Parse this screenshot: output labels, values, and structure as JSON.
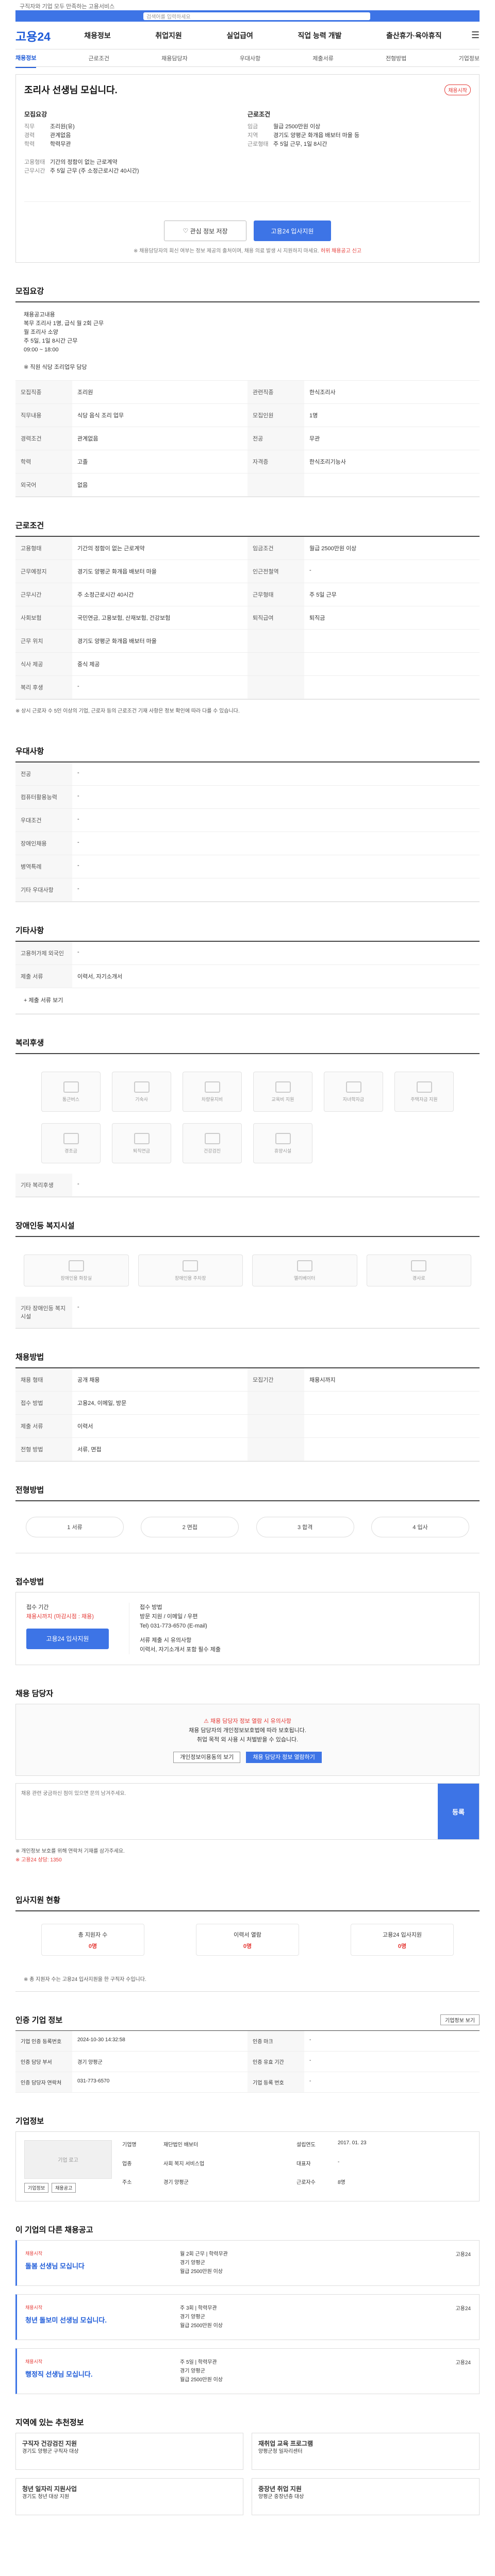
{
  "top": {
    "note": "구직자와 기업 모두 만족하는 고용서비스",
    "search_placeholder": "검색어를 입력하세요"
  },
  "gnb": {
    "logo": "고용24",
    "menu": [
      "채용정보",
      "취업지원",
      "실업급여",
      "직업 능력 개발",
      "출산휴가·육아휴직"
    ]
  },
  "tabs": [
    "채용정보",
    "근로조건",
    "채용담당자",
    "우대사항",
    "제출서류",
    "전형방법",
    "기업정보"
  ],
  "job": {
    "badge": "채용시작",
    "title": "조리사 선생님 모십니다.",
    "recruit_label": "모집요강",
    "cond_label": "근로조건",
    "recruit": [
      {
        "k": "직무",
        "v": "조리원(유)"
      },
      {
        "k": "경력",
        "v": "관계없음"
      },
      {
        "k": "학력",
        "v": "학력무관"
      }
    ],
    "cond": [
      {
        "k": "임금",
        "v": "월급 2500만원 이상"
      },
      {
        "k": "지역",
        "v": "경기도 양평군 화개읍 배보터 마을 등"
      },
      {
        "k": "근로형태",
        "v": "주 5일 근무, 1일 8시간"
      }
    ],
    "contact_k": "고용형태",
    "contact_v": "기간의 정함이 없는 근로계약",
    "time_k": "근무시간",
    "time_v": "주 5일 근무 (주 소정근로시간 40시간)",
    "btn_scrap": "관심 정보 저장",
    "btn_apply": "고용24 입사지원",
    "note": "※ 채용담당자의 회신 여부는 정보 제공의 출처이며, 채용 의료 발생 시 지원하지 마세요.",
    "note_hl": "허위 채용공고 신고"
  },
  "sec_recruit": {
    "title": "모집요강",
    "text": "채용공고내용\n복무 조리사 1명, 급식 월 2회 근무\n월 조리사 소양\n주 5일, 1일 8시간 근무\n09:00 ~ 18:00\n\n※ 직원 식당 조리업무 담당",
    "rows": [
      [
        "모집직종",
        "조리원",
        "관련직종",
        "한식조리사"
      ],
      [
        "직무내용",
        "식당 음식 조리 업무",
        "모집인원",
        "1명"
      ],
      [
        "경력조건",
        "관계없음",
        "전공",
        "무관"
      ],
      [
        "학력",
        "고졸",
        "자격증",
        "한식조리기능사"
      ],
      [
        "외국어",
        "없음",
        "",
        ""
      ]
    ]
  },
  "sec_cond": {
    "title": "근로조건",
    "rows": [
      [
        "고용형태",
        "기간의 정함이 없는 근로계약",
        "임금조건",
        "월급 2500만원 이상"
      ],
      [
        "근무예정지",
        "경기도 양평군 화개읍 배보터 마을",
        "인근전철역",
        "-"
      ],
      [
        "근무시간",
        "주 소정근로시간 40시간",
        "근무형태",
        "주 5일 근무"
      ],
      [
        "사회보험",
        "국민연금, 고용보험, 산재보험, 건강보험",
        "퇴직급여",
        "퇴직금"
      ],
      [
        "근무 위치",
        "경기도 양평군 화개읍 배보터 마을",
        "",
        ""
      ],
      [
        "식사 제공",
        "중식 제공",
        "",
        ""
      ],
      [
        "복리 후생",
        "-",
        "",
        ""
      ]
    ],
    "foot": "※ 상시 근로자 수 5인 이상의 기업, 근로자 등의 근로조건 기재 사항은 정보 확인에 따라 다를 수 있습니다."
  },
  "sec_pref": {
    "title": "우대사항",
    "rows": [
      [
        "전공",
        "-"
      ],
      [
        "컴퓨터활용능력",
        "-"
      ],
      [
        "우대조건",
        "-"
      ],
      [
        "장애인채용",
        "-"
      ],
      [
        "병역특례",
        "-"
      ],
      [
        "기타 우대사항",
        "-"
      ]
    ]
  },
  "sec_doc": {
    "title": "기타사항",
    "rows": [
      [
        "고용허가제 외국인",
        "-"
      ],
      [
        "제출 서류",
        "이력서, 자기소개서"
      ]
    ],
    "more": "+ 제출 서류 보기"
  },
  "sec_welf": {
    "title": "복리후생",
    "items": [
      "통근버스",
      "기숙사",
      "차량유지비",
      "교육비 지원",
      "자녀학자금",
      "주택자금 지원",
      "경조금",
      "퇴직연금",
      "건강검진",
      "휴양시설"
    ],
    "etc_k": "기타 복리후생",
    "etc_v": "-"
  },
  "sec_disab": {
    "title": "장애인등 복지시설",
    "items": [
      "장애인용 화장실",
      "장애인용 주차장",
      "엘리베이터",
      "경사로"
    ],
    "etc_k": "기타 장애인등 복지시설",
    "etc_v": "-"
  },
  "sec_screen": {
    "title": "채용방법",
    "rows": [
      [
        "채용 형태",
        "공개 채용",
        "모집기간",
        "채용시까지"
      ],
      [
        "접수 방법",
        "고용24, 이메일, 방문",
        "",
        ""
      ],
      [
        "제출 서류",
        "이력서",
        "",
        ""
      ],
      [
        "전형 방법",
        "서류, 면접",
        "",
        ""
      ]
    ]
  },
  "sec_proc": {
    "title": "전형방법",
    "steps": [
      "1 서류",
      "2 면접",
      "3 합격",
      "4 입사"
    ]
  },
  "sec_apply": {
    "title": "접수방법",
    "l1": "접수 기간",
    "l2": "채용시까지 (마감시점 : 채용)",
    "apply_btn": "고용24 입사지원",
    "r1": "접수 방법",
    "r2": "방문 지원 / 이메일 / 우편",
    "r3": "Tel) 031-773-6570 (E-mail)",
    "r4": "서류 제출 시 유의사항",
    "r5": "이력서, 자기소개서 포함 필수 제출"
  },
  "sec_mgr": {
    "title": "채용 담당자",
    "hl": "채용 담당자 정보 열람 시 유의사항",
    "l1": "채용 담당자의 개인정보보호법에 따라 보호됩니다.",
    "l2": "취업 목적 외 사용 시 처벌받을 수 있습니다.",
    "b1": "개인정보이용동의 보기",
    "b2": "채용 담당자 정보 열람하기"
  },
  "sec_q": {
    "title": "채용 관련 문의하기",
    "ph": "채용 관련 궁금하신 점이 있으면 문의 남겨주세요.",
    "send": "등록",
    "n1": "※ 개인정보 보호를 위해 연락처 기재를 삼가주세요.",
    "n2": "※ 고용24 상담: 1350"
  },
  "sec_stat": {
    "title": "입사지원 현황",
    "items": [
      {
        "k": "총 지원자 수",
        "v": "0명"
      },
      {
        "k": "이력서 열람",
        "v": "0명"
      },
      {
        "k": "고용24 입사지원",
        "v": "0명"
      }
    ],
    "note": "※ 총 지원자 수는 고용24 입사지원을 한 구직자 수입니다."
  },
  "sec_info": {
    "title": "인증 기업 정보",
    "rows": [
      [
        "기업 인증 등록번호",
        "2024-10-30 14:32:58",
        "인증 마크",
        "-"
      ],
      [
        "인증 담당 부서",
        "경기 양평군",
        "인증 유효 기간",
        "-"
      ],
      [
        "인증 담당자 연락처",
        "031-773-6570",
        "기업 등록 번호",
        "-"
      ]
    ],
    "more": "기업정보 보기"
  },
  "sec_comp": {
    "title": "기업정보",
    "logo": "기업 로고",
    "rows": [
      [
        "기업명",
        "재단법인 배보터",
        "설립연도",
        "2017. 01. 23"
      ],
      [
        "업종",
        "사회 복지 서비스업",
        "대표자",
        "-"
      ],
      [
        "주소",
        "경기 양평군",
        "근로자수",
        "8명"
      ]
    ],
    "b1": "기업정보",
    "b2": "채용공고"
  },
  "sec_jobs": {
    "title": "이 기업의 다른 채용공고",
    "items": [
      {
        "c1": "채용시작",
        "t": "돌봄 선생님 모십니다",
        "m": "월 2회 근무 | 학력무관\n경기 양평군\n월급 2500만원 이상",
        "a": "고용24"
      },
      {
        "c1": "채용시작",
        "t": "청년 돌보미 선생님 모십니다.",
        "m": "주 3회 | 학력무관\n경기 양평군\n월급 2500만원 이상",
        "a": "고용24"
      },
      {
        "c1": "채용시작",
        "t": "행정직 선생님 모십니다.",
        "m": "주 5일 | 학력무관\n경기 양평군\n월급 2500만원 이상",
        "a": "고용24"
      }
    ]
  },
  "sec_ban": {
    "title": "지역에 있는 추천정보",
    "items": [
      {
        "t": "구직자 건강검진 지원",
        "d": "경기도 양평군 구직자 대상"
      },
      {
        "t": "재취업 교육 프로그램",
        "d": "양평군청 일자리센터"
      },
      {
        "t": "청년 일자리 지원사업",
        "d": "경기도 청년 대상 지원"
      },
      {
        "t": "중장년 취업 지원",
        "d": "양평군 중장년층 대상"
      }
    ]
  }
}
